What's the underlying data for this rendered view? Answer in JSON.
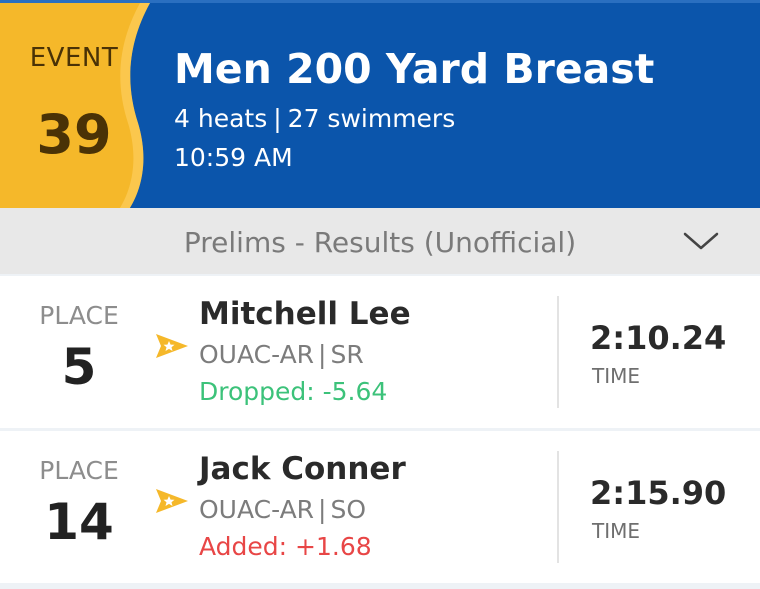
{
  "event": {
    "label": "EVENT",
    "number": "39",
    "title": "Men 200 Yard Breast",
    "heats": "4 heats",
    "separator": "|",
    "swimmers": "27 swimmers",
    "time": "10:59 AM"
  },
  "section": {
    "title": "Prelims - Results (Unofficial)",
    "chevron_icon": "chevron-down-icon"
  },
  "results": [
    {
      "place_label": "PLACE",
      "place": "5",
      "icon": "star-icon",
      "name": "Mitchell Lee",
      "team": "OUAC-AR",
      "separator": "|",
      "year": "SR",
      "diff": "Dropped: -5.64",
      "time": "2:10.24",
      "time_label": "TIME"
    },
    {
      "place_label": "PLACE",
      "place": "14",
      "icon": "star-icon",
      "name": "Jack Conner",
      "team": "OUAC-AR",
      "separator": "|",
      "year": "SO",
      "diff": "Added: +1.68",
      "time": "2:15.90",
      "time_label": "TIME"
    }
  ],
  "colors": {
    "header_blue": "#0b55ab",
    "badge_yellow": "#f5b82a",
    "dropped_green": "#3cc27a",
    "added_red": "#e84646",
    "star_yellow": "#f5b82a"
  }
}
